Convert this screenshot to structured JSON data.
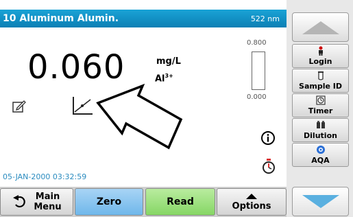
{
  "title_bar": {
    "title": "10 Aluminum Alumin.",
    "wavelength": "522 nm"
  },
  "measurement": {
    "value": "0.060",
    "unit": "mg/L",
    "form_base": "Al",
    "form_charge": "3+",
    "scale_max": "0.800",
    "scale_min": "0.000"
  },
  "datetime": "05-JAN-2000  03:32:59",
  "side_menu": {
    "items": [
      {
        "label": "Login",
        "icon": "person-icon"
      },
      {
        "label": "Sample ID",
        "icon": "vial-icon"
      },
      {
        "label": "Timer",
        "icon": "timer-icon"
      },
      {
        "label": "Dilution",
        "icon": "dilution-icon"
      },
      {
        "label": "AQA",
        "icon": "aqa-icon"
      }
    ]
  },
  "bottom_bar": {
    "main_menu_line1": "Main",
    "main_menu_line2": "Menu",
    "zero": "Zero",
    "read": "Read",
    "options": "Options"
  },
  "colors": {
    "title_bar": "#0b7fb4",
    "zero_button": "#6fb7ea",
    "read_button": "#86d665",
    "scroll_arrow": "#5ab0e0"
  }
}
